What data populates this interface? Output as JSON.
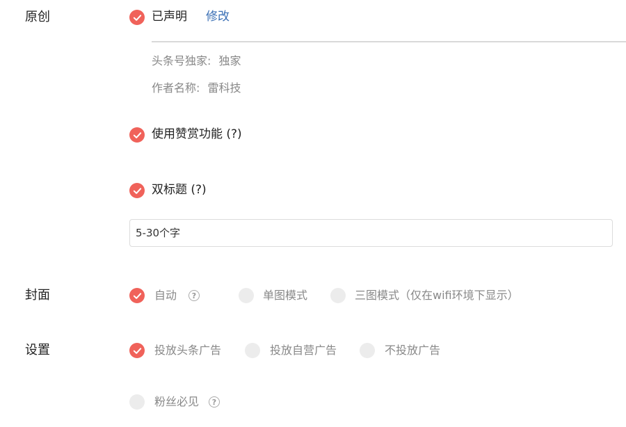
{
  "original": {
    "label": "原创",
    "declared_label": "已声明",
    "modify_link": "修改",
    "exclusive_key": "头条号独家:",
    "exclusive_value": "独家",
    "author_key": "作者名称:",
    "author_value": "雷科技"
  },
  "reward": {
    "label": "使用赞赏功能 (?)",
    "checked": true
  },
  "double_title": {
    "label": "双标题 (?)",
    "checked": true,
    "placeholder": "5-30个字"
  },
  "cover": {
    "label": "封面",
    "options": [
      {
        "label": "自动",
        "checked": true
      },
      {
        "label": "单图模式",
        "checked": false
      },
      {
        "label": "三图模式（仅在wifi环境下显示）",
        "checked": false
      }
    ]
  },
  "settings": {
    "label": "设置",
    "options": [
      {
        "label": "投放头条广告",
        "checked": true
      },
      {
        "label": "投放自营广告",
        "checked": false
      },
      {
        "label": "不投放广告",
        "checked": false
      }
    ],
    "fans_only": {
      "label": "粉丝必见",
      "checked": false
    }
  },
  "colors": {
    "accent": "#f0625a",
    "link": "#3a6fb5",
    "muted": "#888888"
  },
  "icons": {
    "checked": "check-icon",
    "help": "question-circle-icon"
  }
}
